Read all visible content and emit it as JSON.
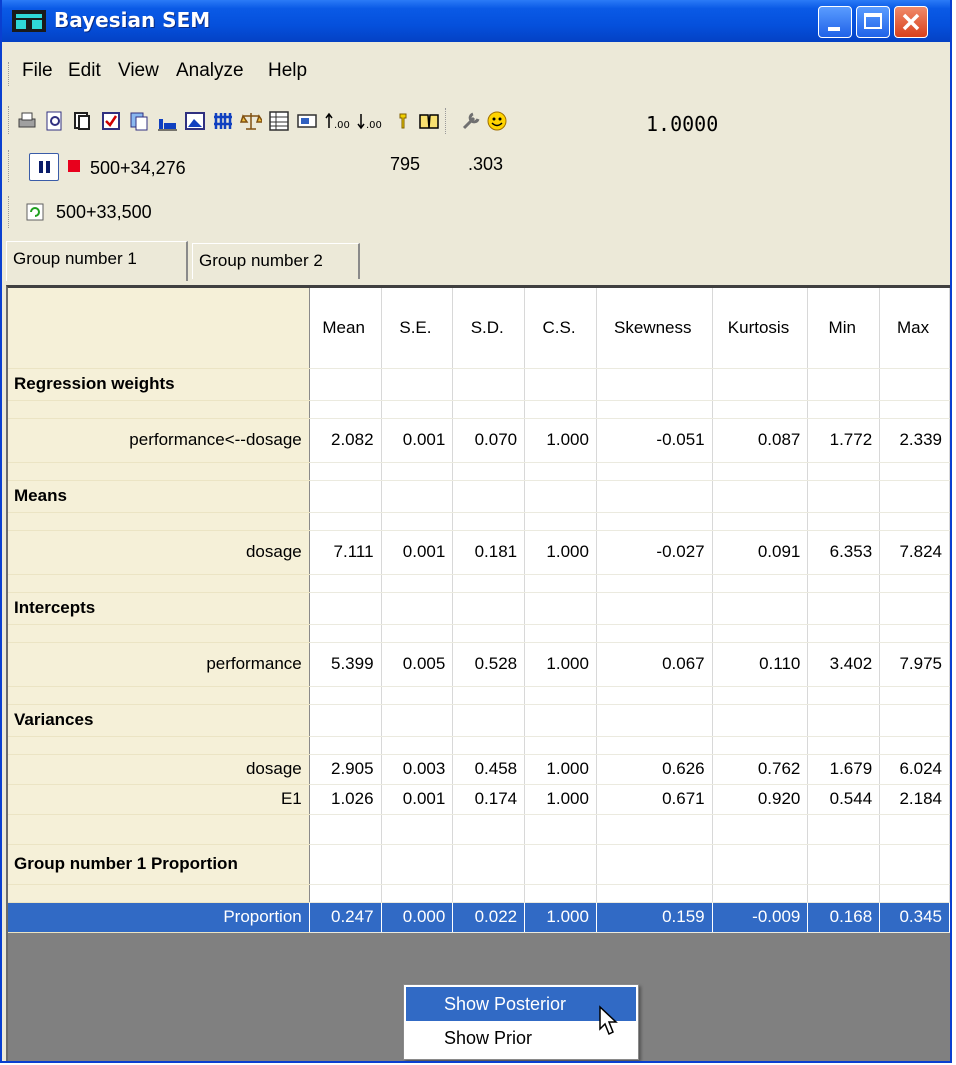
{
  "window": {
    "title": "Bayesian SEM"
  },
  "menu": [
    "File",
    "Edit",
    "View",
    "Analyze",
    "Help"
  ],
  "toolbar": {
    "icons": [
      "print-icon",
      "print-preview-icon",
      "copy-icon",
      "checkbox-icon",
      "paste-icon",
      "bar-chart-icon",
      "image-icon",
      "columns-icon",
      "balance-icon",
      "table-icon",
      "options-icon",
      "increase-decimals-icon",
      "decrease-decimals-icon",
      "light-icon",
      "book-icon",
      "wrench-icon",
      "smiley-icon"
    ],
    "convergence": "1.0000"
  },
  "status": {
    "samples": "500+34,276",
    "count": "795",
    "rate": ".303",
    "retained": "500+33,500"
  },
  "tabs": [
    "Group number 1",
    "Group number 2"
  ],
  "table": {
    "columns": [
      "Mean",
      "S.E.",
      "S.D.",
      "C.S.",
      "Skewness",
      "Kurtosis",
      "Min",
      "Max"
    ],
    "sections": {
      "regression": "Regression weights",
      "means": "Means",
      "intercepts": "Intercepts",
      "variances": "Variances",
      "proportion": "Group number 1 Proportion"
    },
    "rows": {
      "perf_dosage": [
        "performance<--dosage",
        "2.082",
        "0.001",
        "0.070",
        "1.000",
        "-0.051",
        "0.087",
        "1.772",
        "2.339"
      ],
      "dosage_mean": [
        "dosage",
        "7.111",
        "0.001",
        "0.181",
        "1.000",
        "-0.027",
        "0.091",
        "6.353",
        "7.824"
      ],
      "performance": [
        "performance",
        "5.399",
        "0.005",
        "0.528",
        "1.000",
        "0.067",
        "0.110",
        "3.402",
        "7.975"
      ],
      "dosage_var": [
        "dosage",
        "2.905",
        "0.003",
        "0.458",
        "1.000",
        "0.626",
        "0.762",
        "1.679",
        "6.024"
      ],
      "e1": [
        "E1",
        "1.026",
        "0.001",
        "0.174",
        "1.000",
        "0.671",
        "0.920",
        "0.544",
        "2.184"
      ],
      "proportion": [
        "Proportion",
        "0.247",
        "0.000",
        "0.022",
        "1.000",
        "0.159",
        "-0.009",
        "0.168",
        "0.345"
      ]
    }
  },
  "context_menu": [
    "Show Posterior",
    "Show Prior"
  ]
}
